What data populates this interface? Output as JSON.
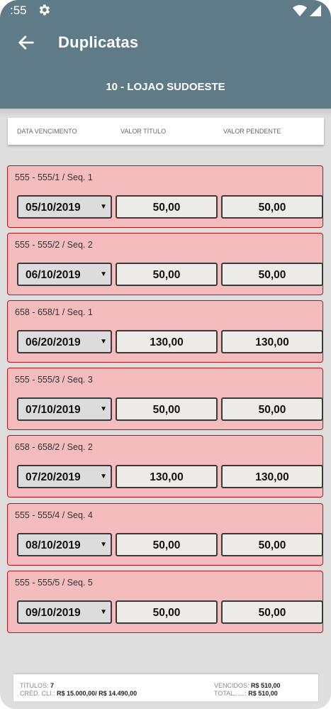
{
  "status": {
    "time": ":55"
  },
  "appbar": {
    "title": "Duplicatas",
    "subtitle": "10 - LOJAO SUDOESTE"
  },
  "columns": {
    "due_date": "DATA VENCIMENTO",
    "value": "VALOR TÍTULO",
    "pending": "VALOR PENDENTE"
  },
  "items": [
    {
      "label": "555 - 555/1 / Seq. 1",
      "date": "05/10/2019",
      "value": "50,00",
      "pending": "50,00"
    },
    {
      "label": "555 - 555/2 / Seq. 2",
      "date": "06/10/2019",
      "value": "50,00",
      "pending": "50,00"
    },
    {
      "label": "658 - 658/1 / Seq. 1",
      "date": "06/20/2019",
      "value": "130,00",
      "pending": "130,00"
    },
    {
      "label": "555 - 555/3 / Seq. 3",
      "date": "07/10/2019",
      "value": "50,00",
      "pending": "50,00"
    },
    {
      "label": "658 - 658/2 / Seq. 2",
      "date": "07/20/2019",
      "value": "130,00",
      "pending": "130,00"
    },
    {
      "label": "555 - 555/4 / Seq. 4",
      "date": "08/10/2019",
      "value": "50,00",
      "pending": "50,00"
    },
    {
      "label": "555 - 555/5 / Seq. 5",
      "date": "09/10/2019",
      "value": "50,00",
      "pending": "50,00"
    }
  ],
  "footer": {
    "titles_label": "TÍTULOS:",
    "titles_value": "7",
    "credit_label": "CRÉD. CLI.:",
    "credit_value": "R$ 15.000,00/ R$ 14.490,00",
    "overdue_label": "VENCIDOS:",
    "overdue_value": "R$ 510,00",
    "total_label": "TOTAL......:",
    "total_value": "R$ 510,00"
  },
  "colors": {
    "appbar": "#5f7b87",
    "card_bg": "#f5bcbd",
    "card_border": "#b5151a",
    "background": "#dedede"
  },
  "icons": {
    "back": "arrow-back-icon",
    "settings": "gear-icon",
    "wifi": "wifi-icon",
    "signal": "signal-icon",
    "dropdown": "dropdown-arrow-icon"
  }
}
